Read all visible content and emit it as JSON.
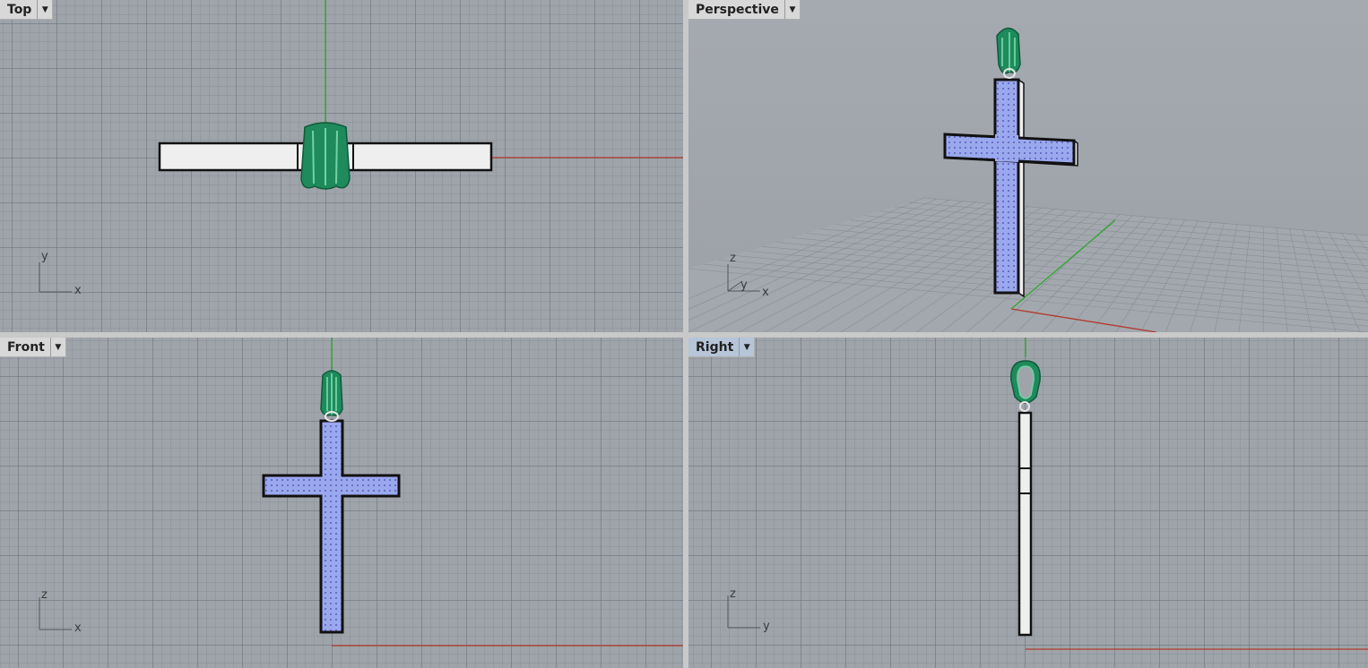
{
  "viewports": {
    "top": {
      "label": "Top",
      "axis_h": "x",
      "axis_v": "y"
    },
    "perspective": {
      "label": "Perspective",
      "axis_z": "z",
      "axis_y": "y",
      "axis_x": "x"
    },
    "front": {
      "label": "Front",
      "axis_h": "x",
      "axis_v": "z"
    },
    "right": {
      "label": "Right",
      "axis_h": "y",
      "axis_v": "z",
      "active": true
    }
  },
  "icons": {
    "dropdown": "chevron-down-icon"
  },
  "colors": {
    "viewport_bg": "#9fa4aa",
    "x_axis": "#b23a2e",
    "y_axis": "#2ea82e",
    "cross_fill": "#9aa8ee",
    "bail": "#1f8a5c",
    "tab_active": "#b6c5d8"
  }
}
